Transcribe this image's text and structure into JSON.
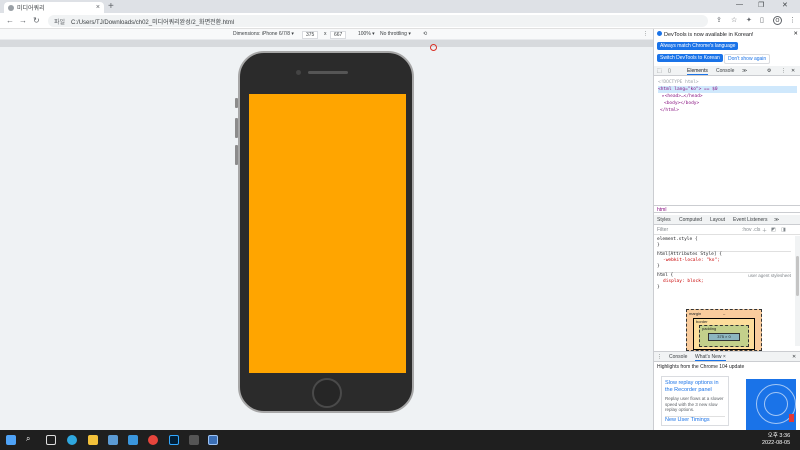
{
  "browser": {
    "tab_title": "미디어쿼리",
    "tab_close": "×",
    "new_tab": "+",
    "address_label": "파일",
    "address": "C:/Users/TJ/Downloads/ch02_미디어쿼리완성/2_화면전환.html",
    "profile_initial": "O"
  },
  "device_toolbar": {
    "dimensions_label": "Dimensions: iPhone 6/7/8 ▾",
    "width": "375",
    "times": "x",
    "height": "667",
    "zoom": "100% ▾",
    "throttling": "No throttling ▾"
  },
  "page": {
    "screen_color": "#ffa500"
  },
  "devtools": {
    "info_message": "DevTools is now available in Korean!",
    "btn_match_language": "Always match Chrome's language",
    "btn_switch_korean": "Switch DevTools to Korean",
    "btn_dont_show": "Don't show again",
    "tab_elements": "Elements",
    "tab_console": "Console",
    "tab_more": "≫",
    "dom_lines": [
      "<!DOCTYPE html>",
      "<html lang=\"ko\"> == $0",
      "▸<head>…</head>",
      "<body></body>",
      "</html>"
    ],
    "breadcrumb": "html",
    "styles_tabs": [
      "Styles",
      "Computed",
      "Layout",
      "Event Listeners",
      "≫"
    ],
    "filter_placeholder": "Filter",
    "filter_hov": ":hov .cls",
    "rules": [
      "element.style {",
      "}",
      "html[Attributes Style] {",
      "-webkit-locale: \"ko\";",
      "}",
      "html {",
      "display: block;",
      "}"
    ],
    "ua_stylesheet": "user agent stylesheet",
    "box_model": {
      "margin": "margin",
      "border": "border",
      "padding": "padding",
      "content": "375 × 0",
      "dash": "–"
    },
    "drawer_console": "Console",
    "drawer_whatsnew": "What's New ×",
    "whatsnew_heading": "Highlights from the Chrome 104 update",
    "card_title": "Slow replay options in the Recorder panel",
    "card_desc": "Replay user flows at a slower speed with the 3 new slow replay options.",
    "card_next": "New User Timings"
  },
  "taskbar": {
    "time": "오후 3:36",
    "date": "2022-08-05"
  }
}
